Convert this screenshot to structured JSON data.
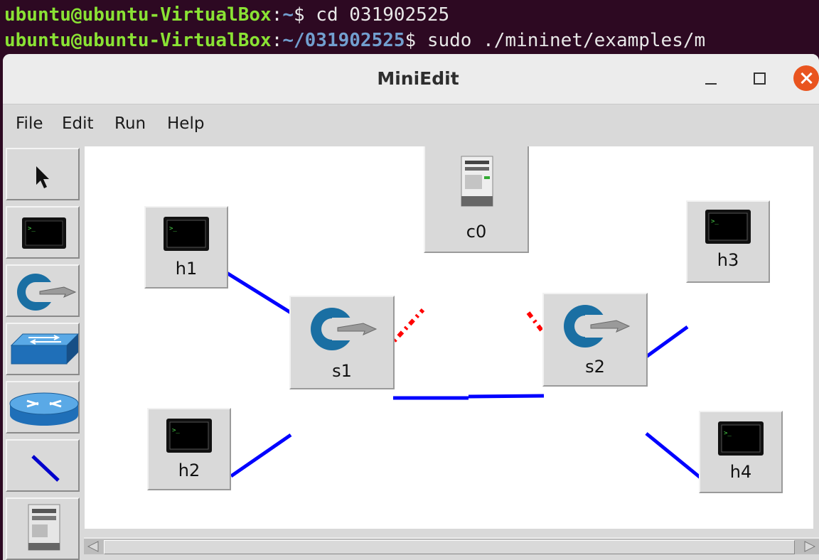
{
  "terminal": {
    "line1": {
      "user": "ubuntu@ubuntu-VirtualBox",
      "sep": ":",
      "path": "~",
      "rest": "$ cd 031902525"
    },
    "line2": {
      "user": "ubuntu@ubuntu-VirtualBox",
      "sep": ":",
      "path": "~/031902525",
      "rest": "$ sudo ./mininet/examples/m"
    }
  },
  "window": {
    "title": "MiniEdit"
  },
  "menu": {
    "file": "File",
    "edit": "Edit",
    "run": "Run",
    "help": "Help"
  },
  "toolbar": {
    "tools": [
      "select-tool",
      "host-tool",
      "switch-tool",
      "legacy-switch-tool",
      "legacy-router-tool",
      "link-tool",
      "controller-tool"
    ]
  },
  "nodes": {
    "c0": "c0",
    "h1": "h1",
    "h2": "h2",
    "h3": "h3",
    "h4": "h4",
    "s1": "s1",
    "s2": "s2"
  },
  "colors": {
    "link": "#0000ff",
    "controller_link": "#ff0000",
    "terminal_bg": "#2d0922",
    "prompt_user": "#8ae234",
    "prompt_path": "#729fcf"
  }
}
